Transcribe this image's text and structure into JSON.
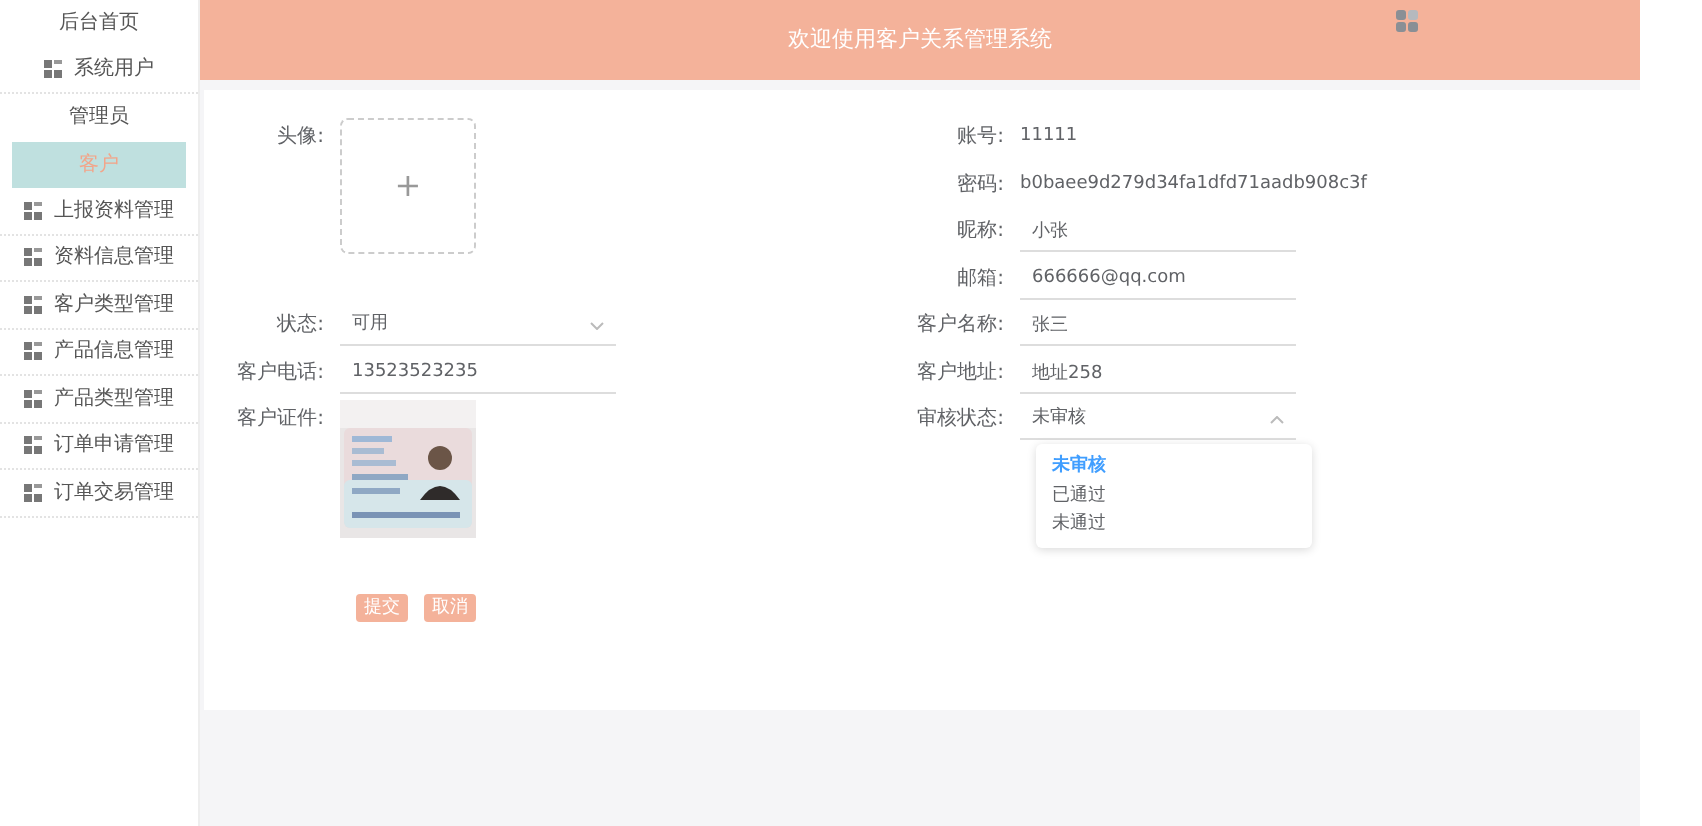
{
  "sidebar": {
    "items": [
      {
        "label": "后台首页",
        "kind": "plain",
        "selected": false
      },
      {
        "label": "系统用户",
        "kind": "icon",
        "selected": false
      },
      {
        "label": "管理员",
        "kind": "plain",
        "selected": false
      },
      {
        "label": "客户",
        "kind": "plain",
        "selected": true
      },
      {
        "label": "上报资料管理",
        "kind": "icon",
        "selected": false
      },
      {
        "label": "资料信息管理",
        "kind": "icon",
        "selected": false
      },
      {
        "label": "客户类型管理",
        "kind": "icon",
        "selected": false
      },
      {
        "label": "产品信息管理",
        "kind": "icon",
        "selected": false
      },
      {
        "label": "产品类型管理",
        "kind": "icon",
        "selected": false
      },
      {
        "label": "订单申请管理",
        "kind": "icon",
        "selected": false
      },
      {
        "label": "订单交易管理",
        "kind": "icon",
        "selected": false
      }
    ]
  },
  "header": {
    "title": "欢迎使用客户关系管理系统"
  },
  "form": {
    "left": [
      {
        "label": "头像:",
        "kind": "upload",
        "value": "+"
      },
      {
        "label": "状态:",
        "kind": "select",
        "value": "可用",
        "expanded": false
      },
      {
        "label": "客户电话:",
        "kind": "input",
        "value": "13523523235"
      },
      {
        "label": "客户证件:"
      }
    ],
    "right": [
      {
        "label": "账号:",
        "kind": "text",
        "value": "11111"
      },
      {
        "label": "密码:",
        "kind": "text",
        "value": "b0baee9d279d34fa1dfd71aadb908c3f"
      },
      {
        "label": "昵称:",
        "kind": "input",
        "value": "小张"
      },
      {
        "label": "邮箱:",
        "kind": "input",
        "value": "666666@qq.com"
      },
      {
        "label": "客户名称:",
        "kind": "input",
        "value": "张三"
      },
      {
        "label": "客户地址:",
        "kind": "input",
        "value": "地址258"
      },
      {
        "label": "审核状态:",
        "kind": "select",
        "value": "未审核",
        "expanded": true,
        "options": [
          {
            "label": "未审核",
            "selected": true
          },
          {
            "label": "已通过",
            "selected": false
          },
          {
            "label": "未通过",
            "selected": false
          }
        ]
      }
    ],
    "buttons": [
      "提交",
      "取消"
    ]
  }
}
